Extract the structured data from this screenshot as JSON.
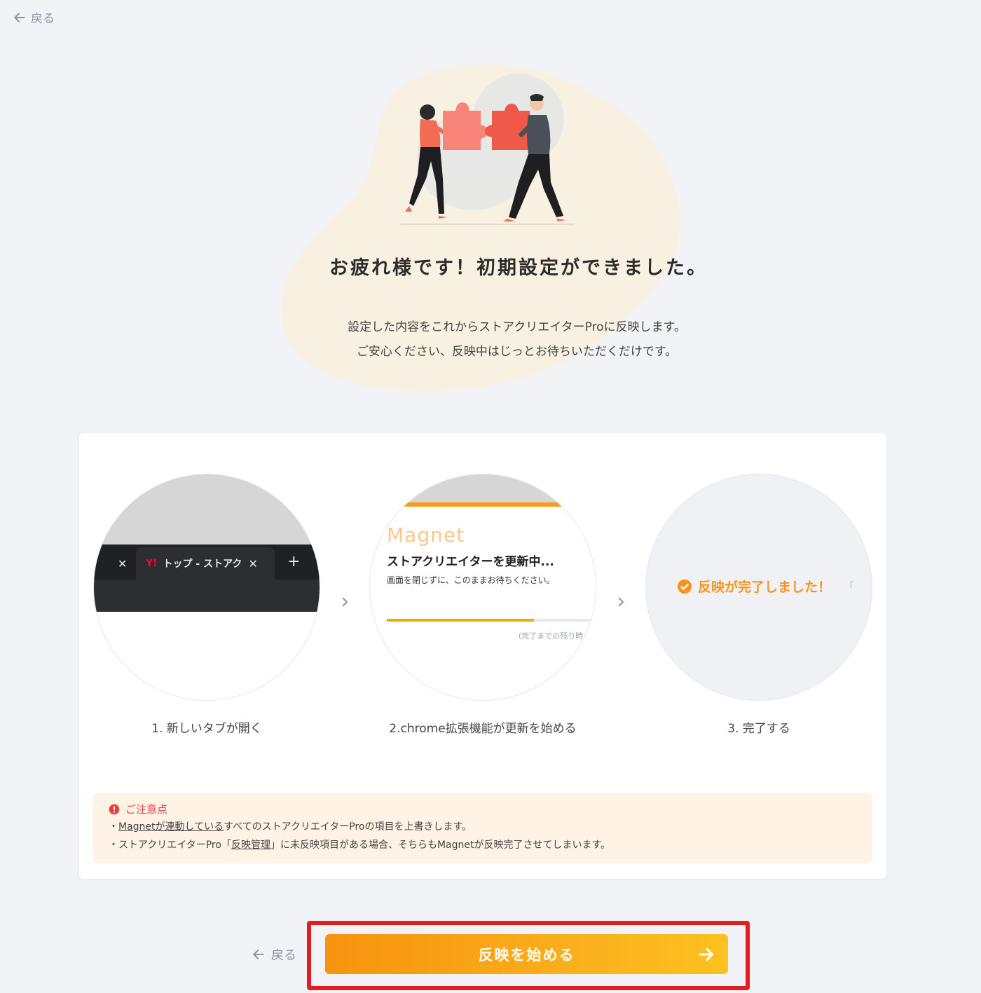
{
  "nav": {
    "back_label": "戻る"
  },
  "hero": {
    "title": "お疲れ様です！初期設定ができました。",
    "desc_line1": "設定した内容をこれからストアクリエイターProに反映します。",
    "desc_line2": "ご安心ください、反映中はじっとお待ちいただくだけです。"
  },
  "steps": [
    {
      "label": "1. 新しいタブが開く",
      "tab_logo": "Y!",
      "tab_title": "トップ - ストアクリエイター",
      "close_glyph": "✕",
      "new_tab_glyph": "+"
    },
    {
      "label": "2.chrome拡張機能が更新を始める",
      "logo": "Magnet",
      "title": "ストアクリエイターを更新中...",
      "subtitle": "画面を閉じずに、このままお待ちください。",
      "progress": 0.7,
      "remaining": "(完了までの残り時"
    },
    {
      "label": "3. 完了する",
      "message": "反映が完了しました！",
      "extra": "「"
    }
  ],
  "notice": {
    "heading": "ご注意点",
    "line1_prefix": "・",
    "line1_link": "Magnetが連動している",
    "line1_suffix": "すべてのストアクリエイターProの項目を上書きします。",
    "line2_prefix": "・ストアクリエイターPro「",
    "line2_link": "反映管理",
    "line2_suffix": "」に未反映項目がある場合、そちらもMagnetが反映完了させてしまいます。"
  },
  "footer": {
    "back_label": "戻る",
    "start_label": "反映を始める"
  },
  "colors": {
    "accent": "#f7941d",
    "highlight_border": "#e41e1e",
    "notice_bg": "#fff3e6",
    "warning": "#e84040"
  }
}
